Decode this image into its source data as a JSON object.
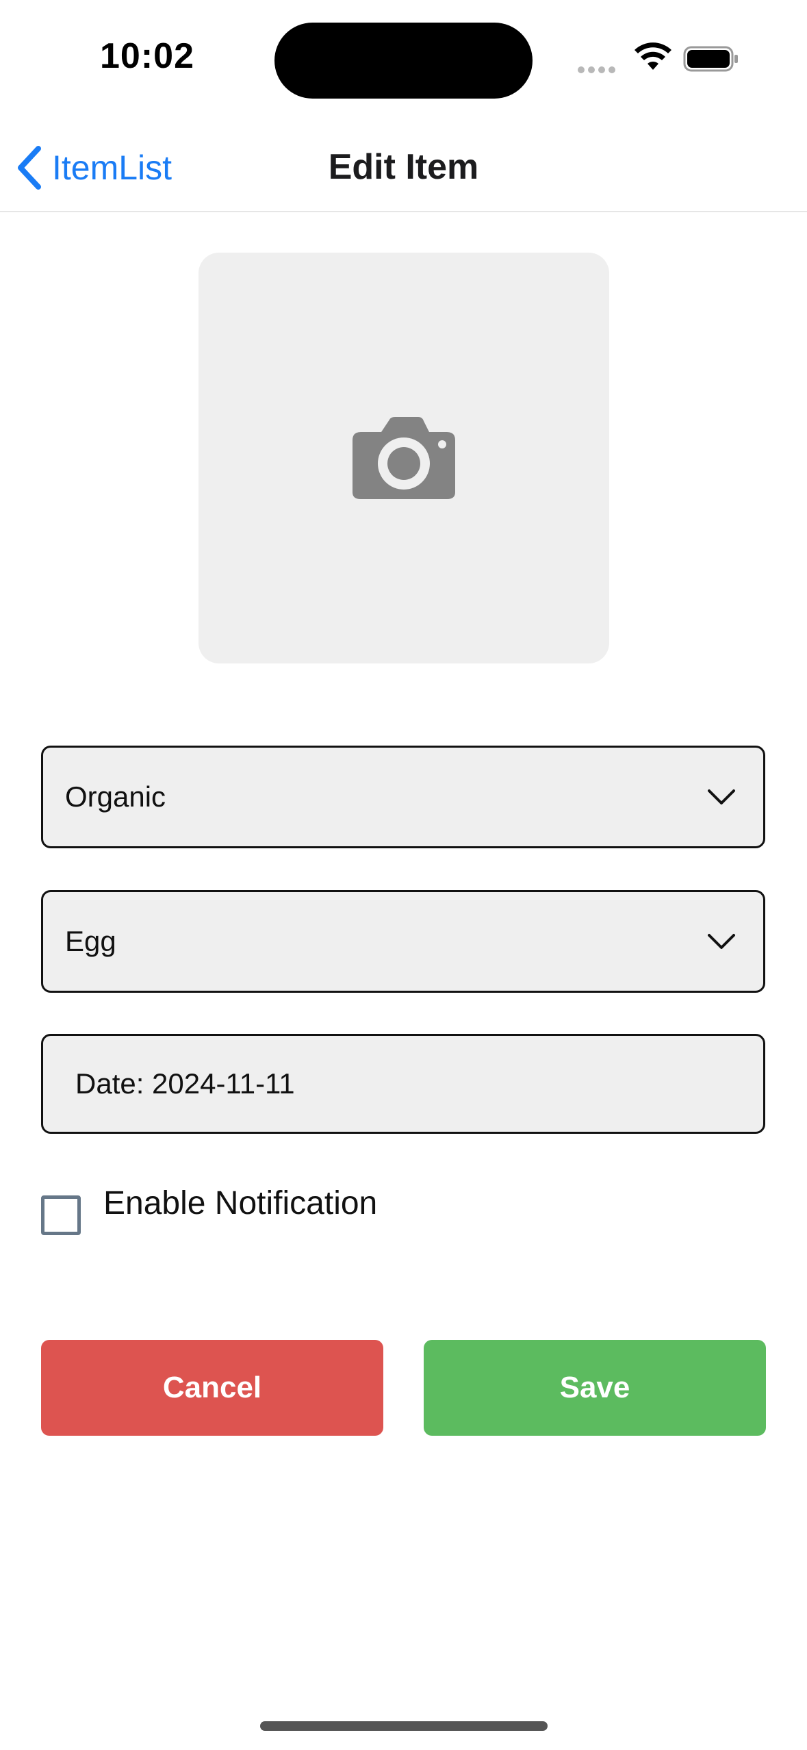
{
  "status_bar": {
    "time": "10:02"
  },
  "navbar": {
    "back_label": "ItemList",
    "title": "Edit Item"
  },
  "photo": {
    "icon": "camera-icon"
  },
  "form": {
    "category_select": {
      "value": "Organic"
    },
    "item_select": {
      "value": "Egg"
    },
    "date_field": {
      "value": "Date: 2024-11-11"
    },
    "notification_checkbox": {
      "label": "Enable Notification",
      "checked": false
    }
  },
  "actions": {
    "cancel_label": "Cancel",
    "save_label": "Save"
  },
  "colors": {
    "accent": "#1a7cf5",
    "cancel": "#dd5450",
    "save": "#5cbb5f",
    "field_bg": "#efefef"
  }
}
